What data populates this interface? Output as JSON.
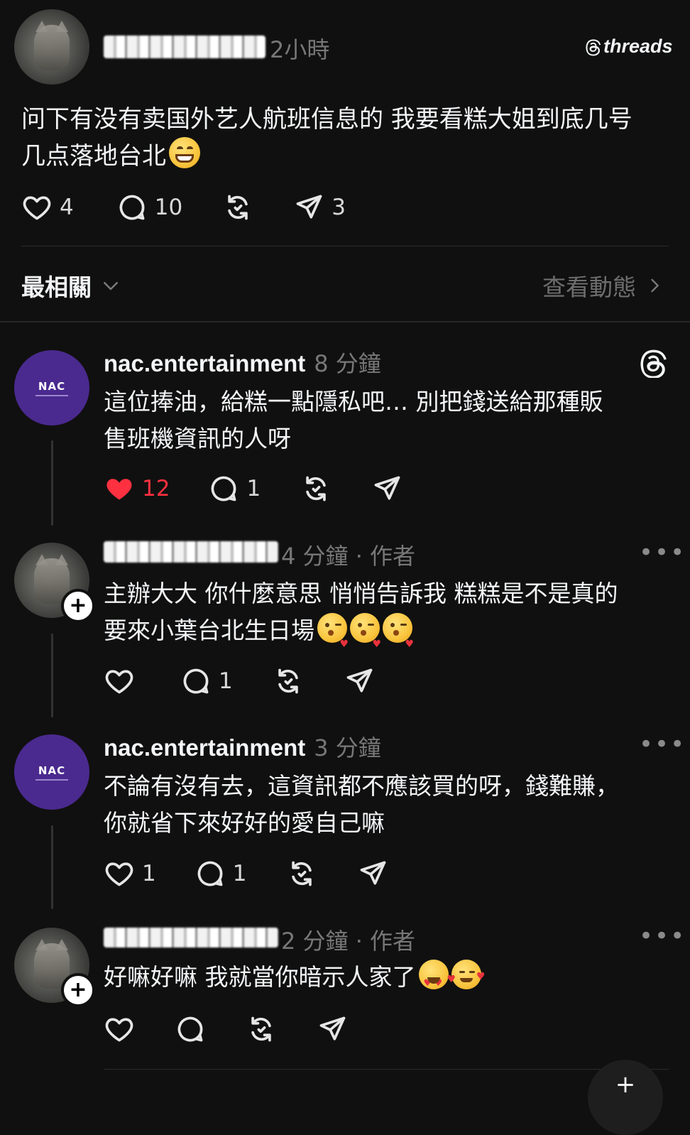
{
  "post": {
    "author": "",
    "time": "2小時",
    "brand": "threads",
    "text_line1": "问下有没有卖国外艺人航班信息的 我要看糕大姐到底几号",
    "text_line2": "几点落地台北",
    "likes": "4",
    "replies": "10",
    "shares": "3"
  },
  "sort": {
    "label": "最相關",
    "view_activity": "查看動態"
  },
  "replies": [
    {
      "username": "nac.entertainment",
      "time": "8 分鐘",
      "line1": "這位捧油，給糕一點隱私吧… 別把錢送給那種販",
      "line2": "售班機資訊的人呀",
      "likes": "12",
      "replies": "1",
      "liked": true
    },
    {
      "username": "",
      "time": "4 分鐘 · 作者",
      "line1": "主辦大大 你什麼意思 悄悄告訴我 糕糕是不是真的",
      "line2": "要來小葉台北生日場",
      "likes": "",
      "replies": "1"
    },
    {
      "username": "nac.entertainment",
      "time": "3 分鐘",
      "line1": "不論有沒有去，這資訊都不應該買的呀，錢難賺，",
      "line2": "你就省下來好好的愛自己嘛",
      "likes": "1",
      "replies": "1"
    },
    {
      "username": "",
      "time": "2 分鐘 · 作者",
      "line1": "好嘛好嘛 我就當你暗示人家了",
      "likes": "",
      "replies": ""
    }
  ],
  "icons": {
    "like": "heart-icon",
    "reply": "comment-icon",
    "repost": "repost-icon",
    "share": "share-icon",
    "more": "more-icon",
    "threads": "threads-logo-icon",
    "chevron_down": "chevron-down-icon",
    "chevron_right": "chevron-right-icon"
  },
  "colors": {
    "background": "#101010",
    "text": "#f3f5f7",
    "muted": "#777777",
    "liked": "#ff3040",
    "nac_avatar": "#4a2a8e"
  },
  "nac_logo_text": "NAC"
}
